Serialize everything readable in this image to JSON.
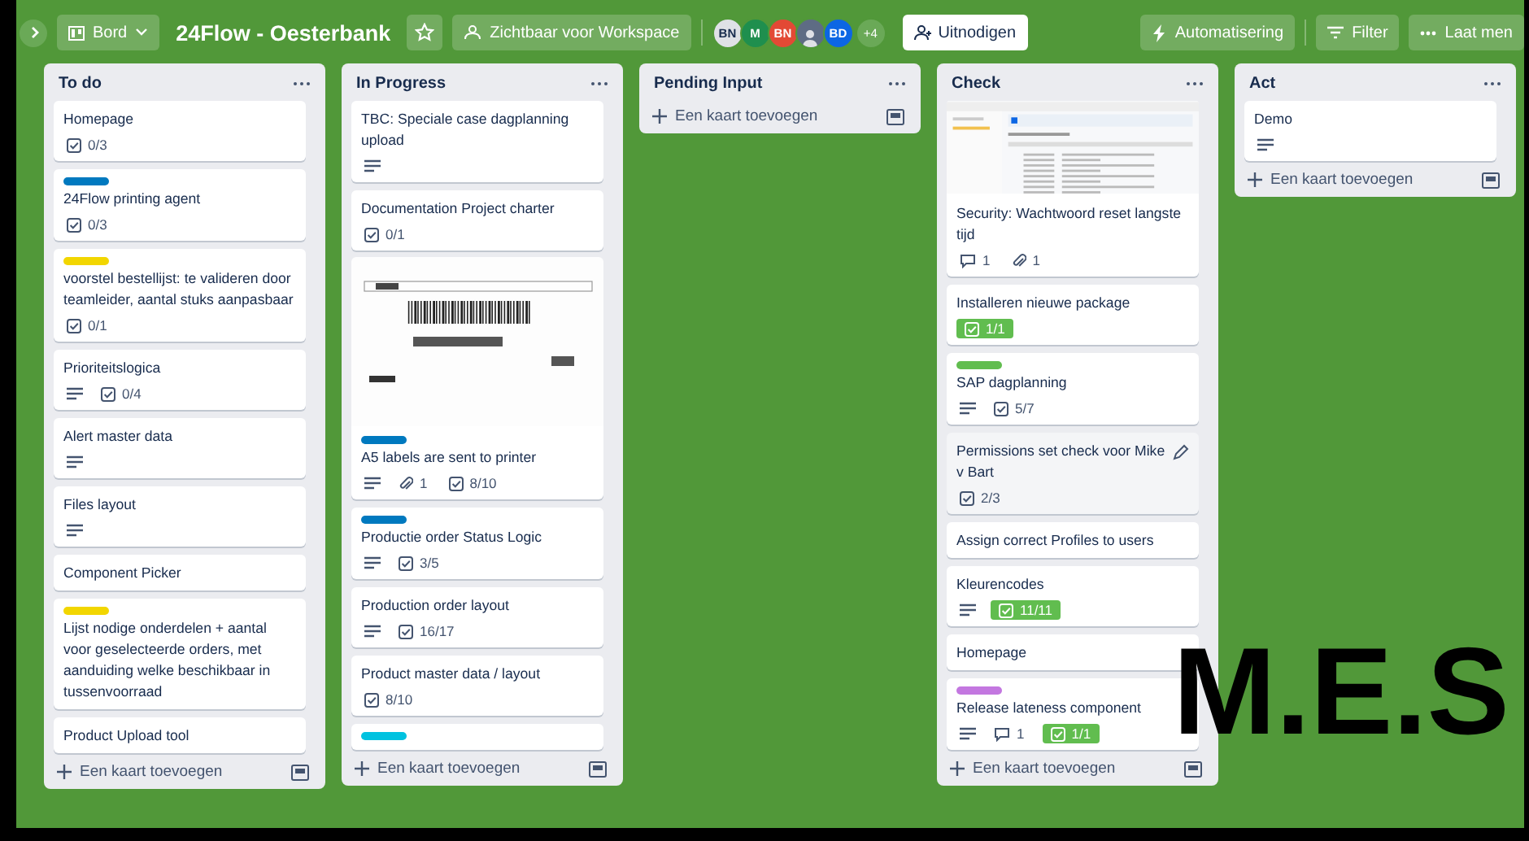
{
  "topbar": {
    "view_switch": "Bord",
    "board_title": "24Flow - Oesterbank",
    "starred": false,
    "visibility": "Zichtbaar voor Workspace",
    "members": [
      {
        "kind": "initials",
        "text": "BN",
        "color": "#dfe1e6"
      },
      {
        "kind": "initials",
        "text": "M",
        "color": "#1f8f4e"
      },
      {
        "kind": "initials",
        "text": "BN",
        "color": "#e34935"
      },
      {
        "kind": "photo"
      },
      {
        "kind": "initials",
        "text": "BD",
        "color": "#0c66e4"
      }
    ],
    "more_members": "+4",
    "invite": "Uitnodigen",
    "automation": "Automatisering",
    "filter": "Filter",
    "more": "Laat men"
  },
  "lists": [
    {
      "title": "To do",
      "add_card": "Een kaart toevoegen",
      "cards": [
        {
          "title": "Homepage",
          "badges": [
            {
              "kind": "checklist",
              "text": "0/3",
              "complete": false
            }
          ]
        },
        {
          "title": "24Flow printing agent",
          "label": {
            "color": "#0079bf"
          },
          "badges": [
            {
              "kind": "checklist",
              "text": "0/3",
              "complete": false
            }
          ]
        },
        {
          "title": "voorstel bestellijst: te valideren door teamleider, aantal stuks aanpasbaar",
          "label": {
            "color": "#f2d600"
          },
          "badges": [
            {
              "kind": "checklist",
              "text": "0/1",
              "complete": false
            }
          ]
        },
        {
          "title": "Prioriteitslogica",
          "badges": [
            {
              "kind": "description"
            },
            {
              "kind": "checklist",
              "text": "0/4",
              "complete": false
            }
          ]
        },
        {
          "title": "Alert master data",
          "badges": [
            {
              "kind": "description"
            }
          ]
        },
        {
          "title": "Files layout",
          "badges": [
            {
              "kind": "description"
            }
          ]
        },
        {
          "title": "Component Picker"
        },
        {
          "title": "Lijst nodige onderdelen + aantal voor geselecteerde orders, met aanduiding welke beschikbaar in tussenvoorraad",
          "label": {
            "color": "#f2d600"
          }
        },
        {
          "title": "Product Upload tool"
        }
      ]
    },
    {
      "title": "In Progress",
      "add_card": "Een kaart toevoegen",
      "cards": [
        {
          "title": "TBC: Speciale case dagplanning upload",
          "badges": [
            {
              "kind": "description"
            }
          ]
        },
        {
          "title": "Documentation Project charter",
          "badges": [
            {
              "kind": "checklist",
              "text": "0/1",
              "complete": false
            }
          ]
        },
        {
          "title": "A5 labels are sent to printer",
          "cover": {
            "kind": "label-photo"
          },
          "label": {
            "color": "#0079bf"
          },
          "badges": [
            {
              "kind": "description"
            },
            {
              "kind": "attachments",
              "text": "1"
            },
            {
              "kind": "checklist",
              "text": "8/10",
              "complete": false
            }
          ]
        },
        {
          "title": "Productie order Status Logic",
          "label": {
            "color": "#0079bf"
          },
          "badges": [
            {
              "kind": "description"
            },
            {
              "kind": "checklist",
              "text": "3/5",
              "complete": false
            }
          ]
        },
        {
          "title": "Production order layout",
          "badges": [
            {
              "kind": "description"
            },
            {
              "kind": "checklist",
              "text": "16/17",
              "complete": false
            }
          ]
        },
        {
          "title": "Product master data / layout",
          "badges": [
            {
              "kind": "checklist",
              "text": "8/10",
              "complete": false
            }
          ]
        },
        {
          "label": {
            "color": "#00c2e0"
          }
        }
      ]
    },
    {
      "title": "Pending Input",
      "add_card": "Een kaart toevoegen"
    },
    {
      "title": "Check",
      "add_card": "Een kaart toevoegen",
      "cards": [
        {
          "title": "Security: Wachtwoord reset langste tijd",
          "cover": {
            "kind": "screenshot"
          },
          "badges": [
            {
              "kind": "comments",
              "text": "1"
            },
            {
              "kind": "attachments",
              "text": "1"
            }
          ]
        },
        {
          "title": "Installeren nieuwe package",
          "badges": [
            {
              "kind": "checklist",
              "text": "1/1",
              "complete": true
            }
          ]
        },
        {
          "title": "SAP dagplanning",
          "label": {
            "color": "#61bd4f"
          },
          "badges": [
            {
              "kind": "description"
            },
            {
              "kind": "checklist",
              "text": "5/7",
              "complete": false
            }
          ]
        },
        {
          "title": "Permissions set check voor Mike v Bart",
          "hovered": true,
          "badges": [
            {
              "kind": "checklist",
              "text": "2/3",
              "complete": false
            }
          ]
        },
        {
          "title": "Assign correct Profiles to users"
        },
        {
          "title": "Kleurencodes",
          "badges": [
            {
              "kind": "description"
            },
            {
              "kind": "checklist",
              "text": "11/11",
              "complete": true
            }
          ]
        },
        {
          "title": "Homepage"
        },
        {
          "title": "Release lateness component",
          "label": {
            "color": "#c377e0"
          },
          "badges": [
            {
              "kind": "description"
            },
            {
              "kind": "comments",
              "text": "1"
            },
            {
              "kind": "checklist",
              "text": "1/1",
              "complete": true
            }
          ]
        }
      ]
    },
    {
      "title": "Act",
      "add_card": "Een kaart toevoegen",
      "cards": [
        {
          "title": "Demo",
          "badges": [
            {
              "kind": "description"
            }
          ]
        }
      ]
    }
  ],
  "overlay_label": "M.E.S"
}
